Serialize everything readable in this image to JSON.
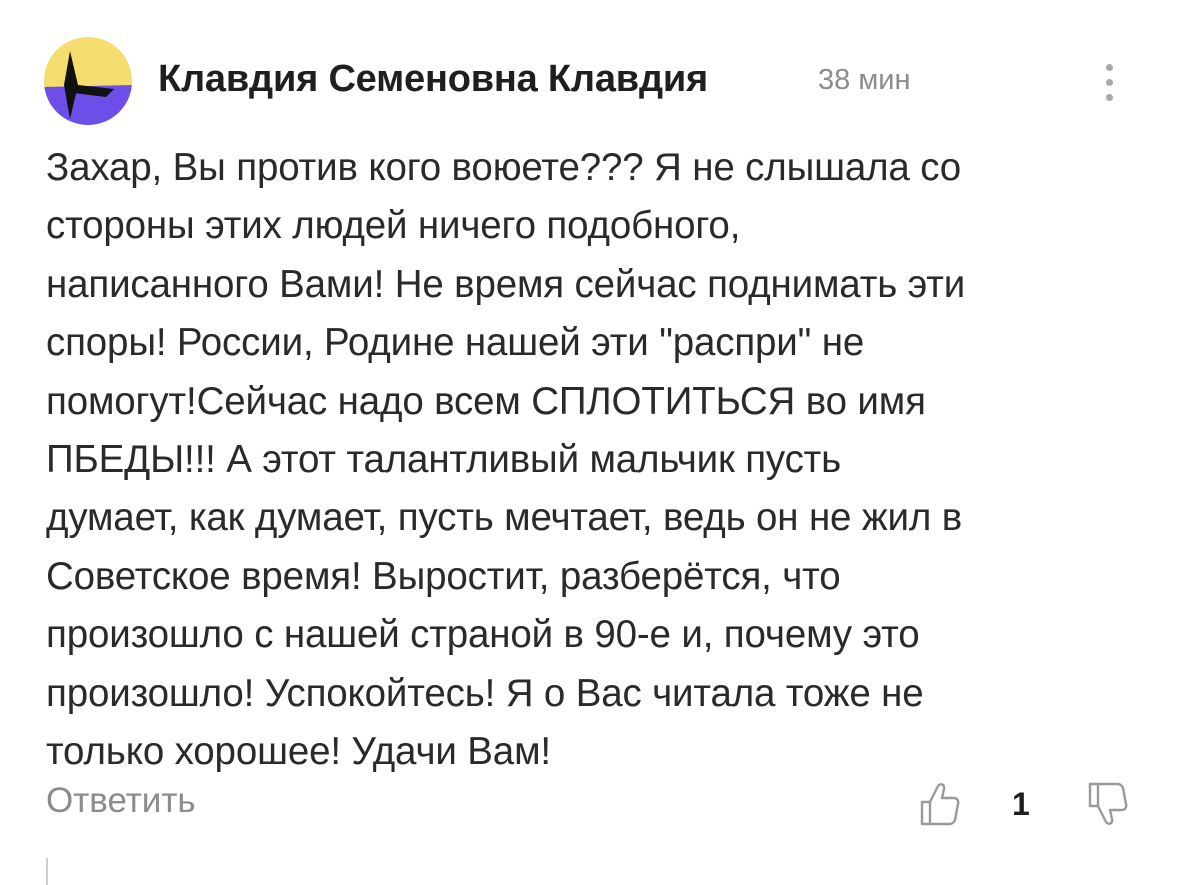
{
  "comment": {
    "author": "Клавдия Семеновна Клавдия",
    "time": "38 мин",
    "text": "Захар, Вы против кого воюете??? Я не слышала со\nстороны этих людей ничего подобного,\nнаписанного Вами! Не время сейчас поднимать эти\nспоры! России, Родине нашей эти \"распри\" не\nпомогут!Сейчас надо всем СПЛОТИТЬСЯ во имя\nПБЕДЫ!!! А этот талантливый мальчик пусть\nдумает, как думает, пусть мечтает, ведь он не жил в\nСоветское время! Выростит, разберётся, что\nпроизошло с нашей страной в 90-е и, почему это\nпроизошло! Успокойтесь! Я о Вас читала тоже не\nтолько хорошее! Удачи Вам!",
    "reply_label": "Ответить",
    "like_count": "1"
  },
  "icons": {
    "avatar": "abstract-yellow-purple-avatar",
    "more": "vertical-dots-icon",
    "like": "thumb-up-icon",
    "dislike": "thumb-down-icon"
  },
  "colors": {
    "avatar_yellow": "#f5dc6e",
    "avatar_purple": "#6d4ee8",
    "avatar_black": "#111111",
    "text_primary": "#1f1f1f",
    "text_muted": "#8c8c8c"
  }
}
